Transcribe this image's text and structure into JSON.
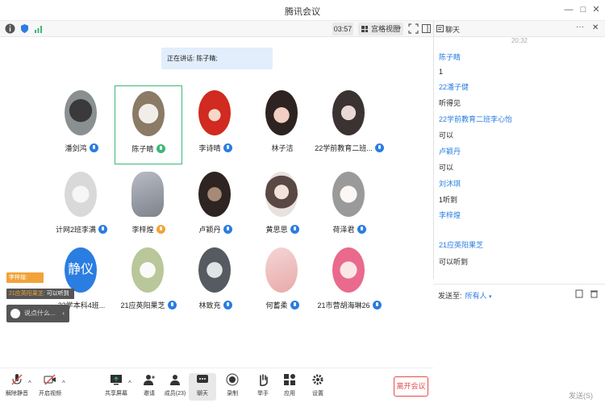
{
  "window": {
    "title": "腾讯会议"
  },
  "toolbar": {
    "timer": "03:57",
    "view_label": "宫格视图"
  },
  "chat": {
    "header": "聊天",
    "time": "20:32",
    "messages": [
      {
        "sender": "陈子睛",
        "text": "1"
      },
      {
        "sender": "22潘子健",
        "text": "听得见"
      },
      {
        "sender": "22学前教育二班李心怡",
        "text": "可以"
      },
      {
        "sender": "卢颖丹",
        "text": "可以"
      },
      {
        "sender": "刘沐琪",
        "text": "1听到"
      },
      {
        "sender": "李梓煌",
        "text": ""
      },
      {
        "sender": "21应英阳果芝",
        "text": "可以听到"
      }
    ],
    "send_to_label": "发送至:",
    "send_to_value": "所有人",
    "send_button": "发送(S)"
  },
  "stage": {
    "speaking": "正在讲话: 陈子睛;",
    "participants": [
      {
        "name": "潘剑鸿"
      },
      {
        "name": "陈子睛"
      },
      {
        "name": "李诗晴"
      },
      {
        "name": "林子洁"
      },
      {
        "name": "22学前教育二班..."
      },
      {
        "name": "计网2班李满"
      },
      {
        "name": "李梓煌"
      },
      {
        "name": "卢颖丹"
      },
      {
        "name": "黄思思"
      },
      {
        "name": "荷泽君"
      },
      {
        "name": "22学本科4班...",
        "avatar_text": "静仪"
      },
      {
        "name": "21应英阳果芝"
      },
      {
        "name": "林致充"
      },
      {
        "name": "何蓄柔"
      },
      {
        "name": "21市营胡海琳26"
      }
    ]
  },
  "overlay": {
    "tag1": "李梓煌:",
    "tag2_name": "21应英阳果芝:",
    "tag2_msg": "可以听到",
    "say_placeholder": "说点什么..."
  },
  "bottombar": {
    "mute": "解除静音",
    "video": "开启视频",
    "share": "共享屏幕",
    "invite": "邀请",
    "members": "成员(23)",
    "chat": "聊天",
    "record": "录制",
    "raise": "举手",
    "apps": "应用",
    "settings": "设置",
    "leave": "离开会议"
  }
}
